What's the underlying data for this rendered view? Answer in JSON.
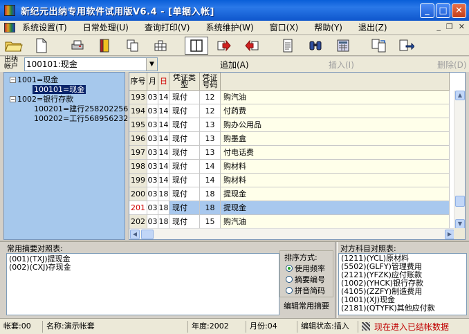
{
  "window": {
    "title": "新纪元出纳专用软件试用版V6.4 - [单据入帐]",
    "minimize": "_",
    "maximize": "□",
    "close": "✕"
  },
  "menu": {
    "items": [
      "系统设置(T)",
      "日常处理(U)",
      "查询打印(V)",
      "系统维护(W)",
      "窗口(X)",
      "帮助(Y)",
      "退出(Z)"
    ],
    "mdi_minimize": "_",
    "mdi_restore": "❐",
    "mdi_close": "✕"
  },
  "toolbar": {
    "icons": [
      "open-folder-icon",
      "new-document-icon",
      "print-icon",
      "notebook-icon",
      "copy-icon",
      "grid-icon",
      "split-view-icon",
      "arrow-right-icon",
      "arrow-left-icon",
      "document-icon",
      "binoculars-icon",
      "calculator-icon",
      "transfer-icon",
      "export-icon"
    ]
  },
  "account": {
    "label": "出纳帐户",
    "value": "100101:现金",
    "add_label": "追加(A)",
    "insert_label": "插入(I)",
    "delete_label": "删除(D)"
  },
  "tree": {
    "nodes": [
      {
        "label": "1001=现金",
        "level": 0,
        "expanded": true
      },
      {
        "label": "100101=现金",
        "level": 1,
        "selected": true
      },
      {
        "label": "1002=银行存款",
        "level": 0,
        "expanded": true
      },
      {
        "label": "100201=建行258202256",
        "level": 1
      },
      {
        "label": "100202=工行568956232",
        "level": 1
      }
    ]
  },
  "grid": {
    "headers": {
      "seq": "序号",
      "month": "月",
      "day": "日",
      "voucher_type": "凭证类型",
      "voucher_no": "凭证号码",
      "summary": ""
    },
    "rows": [
      {
        "seq": "193",
        "month": "03",
        "day": "14",
        "type": "现付",
        "no": "12",
        "summary": "购汽油"
      },
      {
        "seq": "194",
        "month": "03",
        "day": "14",
        "type": "现付",
        "no": "12",
        "summary": "付药费"
      },
      {
        "seq": "195",
        "month": "03",
        "day": "14",
        "type": "现付",
        "no": "13",
        "summary": "购办公用品"
      },
      {
        "seq": "196",
        "month": "03",
        "day": "14",
        "type": "现付",
        "no": "13",
        "summary": "购墨盒"
      },
      {
        "seq": "197",
        "month": "03",
        "day": "14",
        "type": "现付",
        "no": "13",
        "summary": "付电话费"
      },
      {
        "seq": "198",
        "month": "03",
        "day": "14",
        "type": "现付",
        "no": "14",
        "summary": "购材料"
      },
      {
        "seq": "199",
        "month": "03",
        "day": "14",
        "type": "现付",
        "no": "14",
        "summary": "购材料"
      },
      {
        "seq": "200",
        "month": "03",
        "day": "18",
        "type": "现付",
        "no": "18",
        "summary": "提现金"
      },
      {
        "seq": "201",
        "month": "03",
        "day": "18",
        "type": "现付",
        "no": "18",
        "summary": "提现金",
        "active": true
      },
      {
        "seq": "202",
        "month": "03",
        "day": "18",
        "type": "现付",
        "no": "15",
        "summary": "购汽油"
      }
    ]
  },
  "phrases": {
    "title": "常用摘要对照表:",
    "items": [
      "(001)(TXJ)提现金",
      "(002)(CXJ)存现金"
    ],
    "sort_title": "排序方式:",
    "sort_options": [
      "使用频率",
      "摘要编号",
      "拼音简码"
    ],
    "sort_selected": 0,
    "edit_button": "编辑常用摘要"
  },
  "counter_accounts": {
    "title": "对方科目对照表:",
    "items": [
      "(1211)(YCL)原材料",
      "(5502)(GLFY)管理费用",
      "(2121)(YFZK)应付账款",
      "(1002)(YHCK)银行存款",
      "(4105)(ZZFY)制造费用",
      "(1001)(XJ)现金",
      "(2181)(QTYFK)其他应付款"
    ]
  },
  "status": {
    "book": "帐套:00",
    "name": "名称:演示帐套",
    "year": "年度:2002",
    "month": "月份:04",
    "edit_state": "编辑状态:插入",
    "message": "现在进入已结帐数据"
  }
}
